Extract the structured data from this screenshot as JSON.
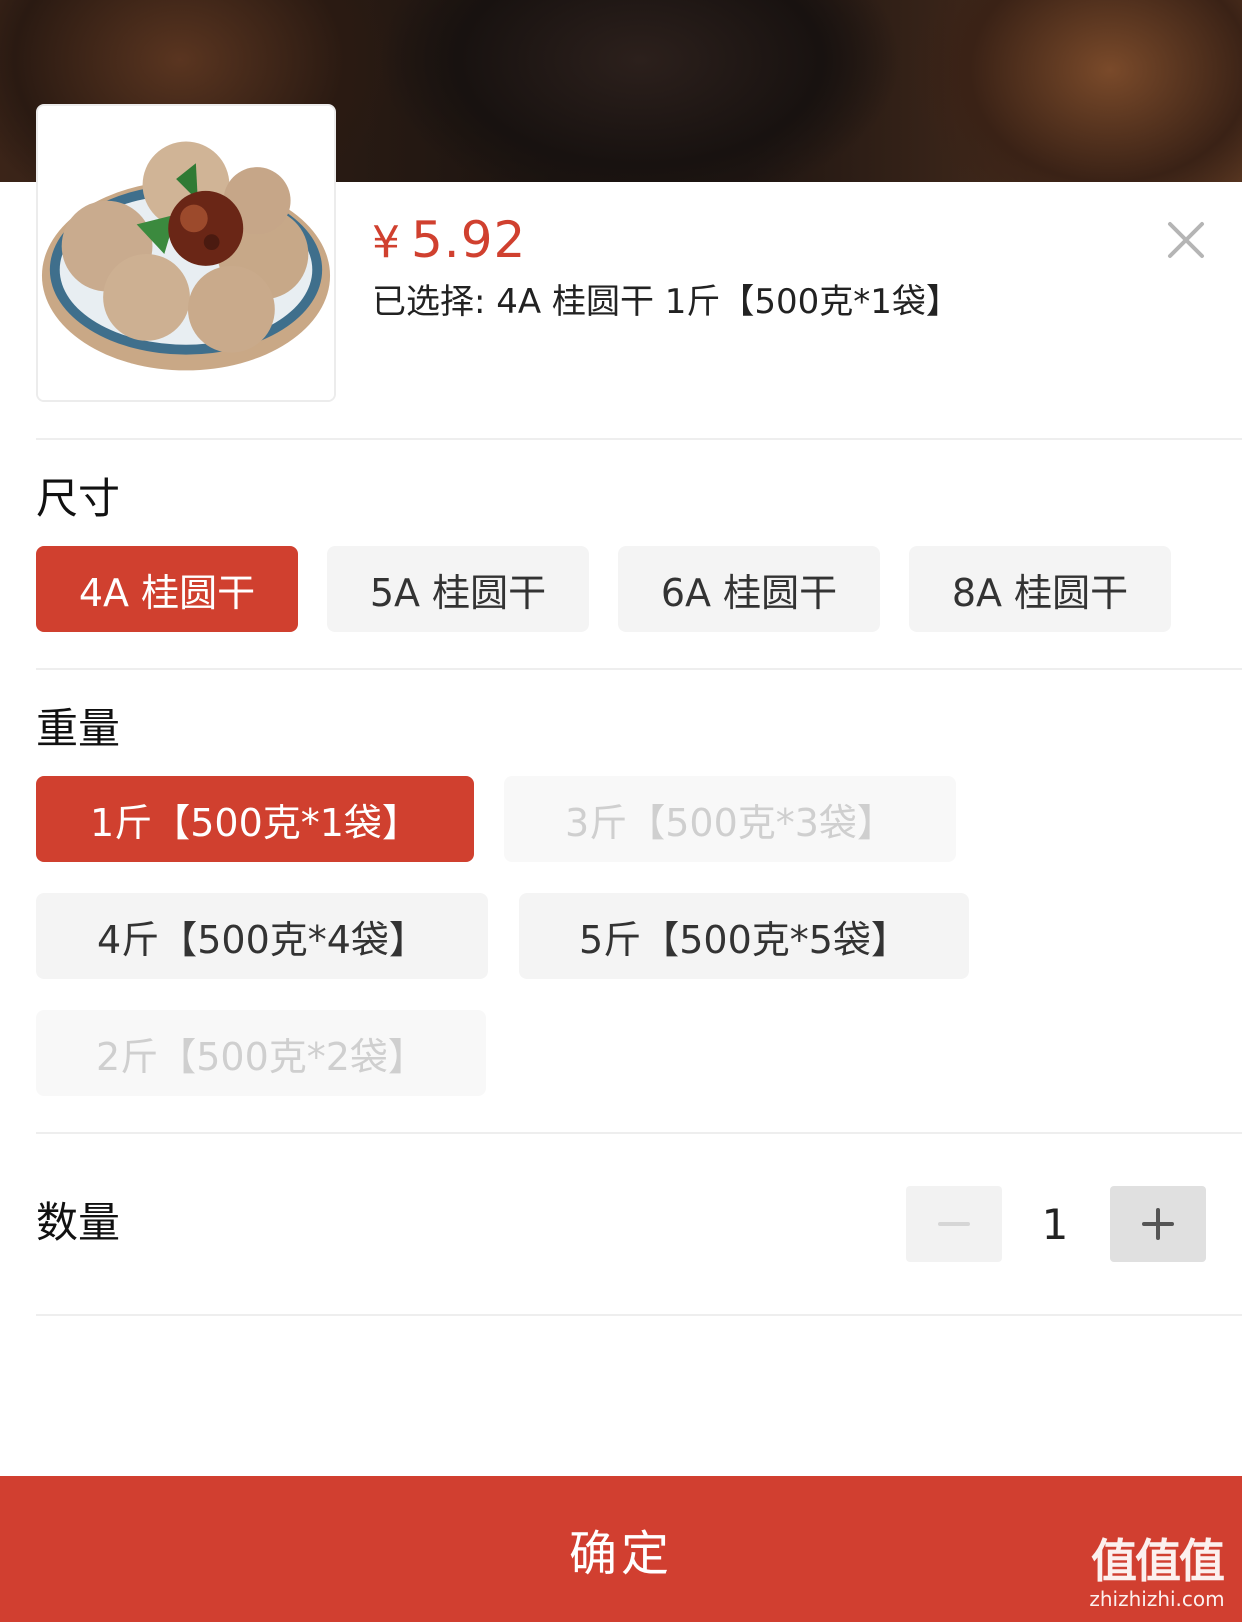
{
  "product": {
    "currency": "¥",
    "price": "5.92",
    "selected_text": "已选择: 4A 桂圆干 1斤【500克*1袋】"
  },
  "sections": {
    "size": {
      "title": "尺寸",
      "options": [
        {
          "label": "4A 桂圆干",
          "state": "selected"
        },
        {
          "label": "5A 桂圆干",
          "state": "normal"
        },
        {
          "label": "6A 桂圆干",
          "state": "normal"
        },
        {
          "label": "8A 桂圆干",
          "state": "normal"
        }
      ]
    },
    "weight": {
      "title": "重量",
      "options": [
        {
          "label": "1斤【500克*1袋】",
          "state": "selected"
        },
        {
          "label": "3斤【500克*3袋】",
          "state": "disabled"
        },
        {
          "label": "4斤【500克*4袋】",
          "state": "normal"
        },
        {
          "label": "5斤【500克*5袋】",
          "state": "normal"
        },
        {
          "label": "2斤【500克*2袋】",
          "state": "disabled"
        }
      ]
    }
  },
  "quantity": {
    "label": "数量",
    "value": "1"
  },
  "confirm_label": "确定",
  "watermark": {
    "main": "值值值",
    "sub": "zhizhizhi.com"
  },
  "colors": {
    "accent": "#d0402f",
    "chip_bg": "#f4f4f4",
    "disabled_text": "#cfcfcf"
  },
  "icons": {
    "close": "close-icon",
    "minus": "minus-icon",
    "plus": "plus-icon"
  }
}
